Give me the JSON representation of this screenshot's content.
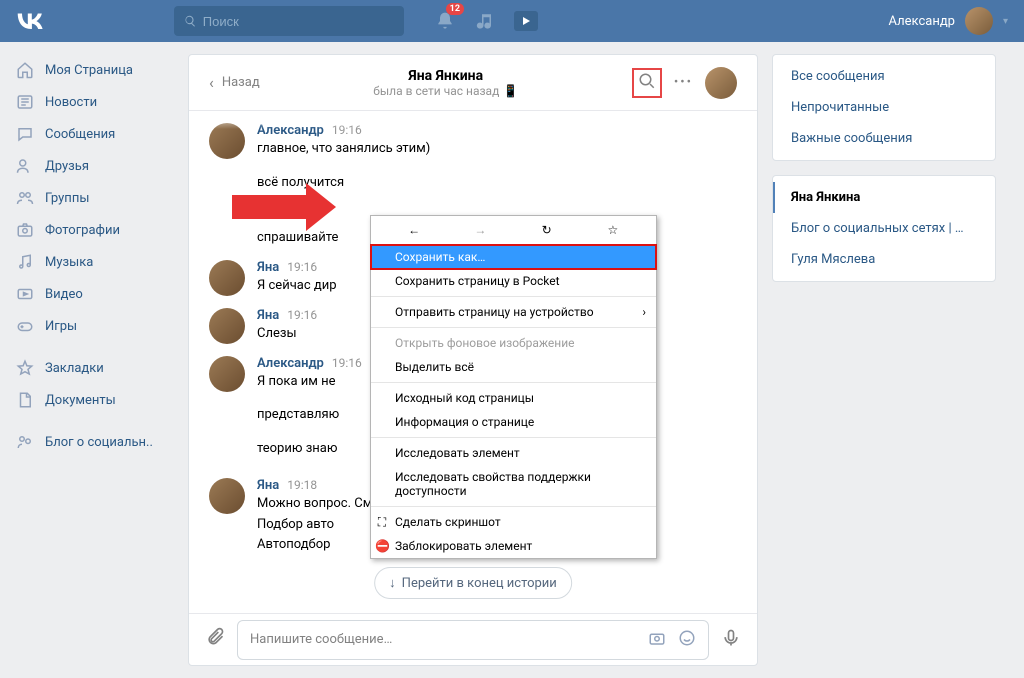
{
  "header": {
    "search_placeholder": "Поиск",
    "notification_count": "12",
    "username": "Александр"
  },
  "sidebar": {
    "items": [
      "Моя Страница",
      "Новости",
      "Сообщения",
      "Друзья",
      "Группы",
      "Фотографии",
      "Музыка",
      "Видео",
      "Игры"
    ],
    "extra": [
      "Закладки",
      "Документы"
    ],
    "last": "Блог о социальн.."
  },
  "chat": {
    "back": "Назад",
    "title": "Яна Янкина",
    "status": "была в сети час назад",
    "messages": [
      {
        "name": "Александр",
        "time": "19:16",
        "lines": [
          "главное, что занялись этим)",
          "всё получится",
          "",
          "спрашивайте"
        ]
      },
      {
        "name": "Яна",
        "time": "19:16",
        "lines": [
          "Я сейчас дир"
        ]
      },
      {
        "name": "Яна",
        "time": "19:16",
        "lines": [
          "Слезы"
        ]
      },
      {
        "name": "Александр",
        "time": "19:16",
        "lines": [
          "Я пока им не",
          "представляю",
          "теорию знаю"
        ]
      },
      {
        "name": "Яна",
        "time": "19:18",
        "lines": [
          "Можно вопрос. Смотрите кто то ишет",
          "Подбор авто",
          "Автоподбор"
        ]
      }
    ],
    "jump": "Перейти в конец истории",
    "input_placeholder": "Напишите сообщение…"
  },
  "right": {
    "filters": [
      "Все сообщения",
      "Непрочитанные",
      "Важные сообщения"
    ],
    "convos": [
      {
        "label": "Яна Янкина",
        "active": true
      },
      {
        "label": "Блог о социальных сетях | …",
        "active": false
      },
      {
        "label": "Гуля Мяслева",
        "active": false
      }
    ]
  },
  "context": {
    "items": [
      {
        "label": "Сохранить как…",
        "highlighted": true
      },
      {
        "label": "Сохранить страницу в Pocket"
      },
      {
        "sep": true
      },
      {
        "label": "Отправить страницу на устройство",
        "sub": true
      },
      {
        "sep": true
      },
      {
        "label": "Открыть фоновое изображение",
        "disabled": true
      },
      {
        "label": "Выделить всё"
      },
      {
        "sep": true
      },
      {
        "label": "Исходный код страницы"
      },
      {
        "label": "Информация о странице"
      },
      {
        "sep": true
      },
      {
        "label": "Исследовать элемент"
      },
      {
        "label": "Исследовать свойства поддержки доступности"
      },
      {
        "sep": true
      },
      {
        "label": "Сделать скриншот",
        "icon": "⛶"
      },
      {
        "label": "Заблокировать элемент",
        "icon": "⛔"
      }
    ]
  }
}
